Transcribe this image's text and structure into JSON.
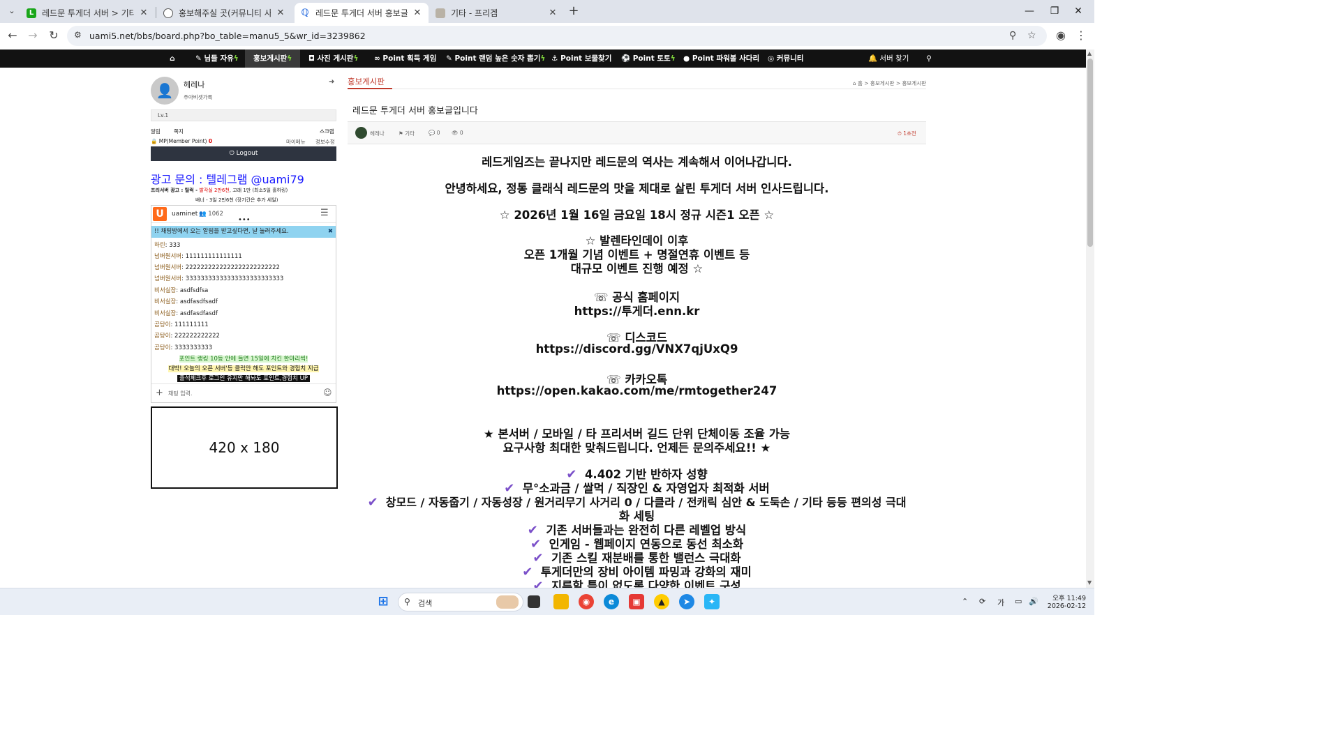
{
  "browser": {
    "tabs": [
      {
        "title": "레드문 투게더 서버 > 기타 프리",
        "active": false,
        "favicon_color": "#1aa61a",
        "favicon_letter": "L"
      },
      {
        "title": "홍보해주실 곳(커뮤니티 사이트",
        "active": false,
        "favicon_color": "#666666",
        "favicon_letter": ""
      },
      {
        "title": "레드문 투게더 서버 홍보글입니",
        "active": true,
        "favicon_color": "#2a6de0",
        "favicon_letter": ""
      },
      {
        "title": "기타 - 프리겜",
        "active": false,
        "favicon_color": "#888888",
        "favicon_letter": ""
      }
    ],
    "new_tab_glyph": "+",
    "url": "uami5.net/bbs/board.php?bo_table=manu5_5&wr_id=3239862"
  },
  "site_nav": {
    "items": [
      {
        "label": "님들 자유",
        "bolt": true,
        "icon": "pencil-icon"
      },
      {
        "label": "홍보게시판",
        "bolt": true,
        "active": true
      },
      {
        "label": "사진 게시판",
        "bolt": true,
        "icon": "camera-icon"
      },
      {
        "label": "Point 획득 게임",
        "bolt": false,
        "icon": "gamepad-icon"
      },
      {
        "label": "Point 랜덤 높은 숫자 뽑기",
        "bolt": true,
        "icon": "pencil-icon"
      },
      {
        "label": "Point 보물찾기",
        "bolt": false,
        "icon": "anchor-icon"
      },
      {
        "label": "Point 토토",
        "bolt": true,
        "icon": "soccer-icon"
      },
      {
        "label": "Point 파워볼 사다리",
        "bolt": false,
        "icon": "ball-icon"
      },
      {
        "label": "커뮤니티",
        "bolt": false,
        "icon": "eye-icon"
      },
      {
        "label": "서버 찾기",
        "bolt": false,
        "icon": "bell-icon"
      }
    ]
  },
  "sidebar": {
    "username": "헤레나",
    "subtitle": "주아비셋가륵",
    "level": "Lv.1",
    "links": [
      "알림",
      "쪽지",
      "스크랩"
    ],
    "mp_label": "MP(Member Point)",
    "mp_value": "0",
    "my_links": [
      "마이메뉴",
      "정보수정"
    ],
    "logout": "Logout",
    "ad_title": "광고 문의 :  텔레그램 @uami79",
    "ad_line1_prefix": "프리서버 광고 : 틸럭 - ",
    "ad_line1_price": "발각실 2만6천",
    "ad_line1_suffix": ", 고래 1만 (최소5일 홀하링)",
    "ad_line2": "배너 - 3일 2만6천 (장기간은 추가 세일)"
  },
  "chat": {
    "room": "uaminet",
    "users": "1062",
    "notice": "!! 채팅방에서 오는 알림을 받고싶다면, 날 눌러주세요.",
    "messages": [
      {
        "nick": "하린",
        "text": "333"
      },
      {
        "nick": "넘버원서버",
        "text": "111111111111111"
      },
      {
        "nick": "넘버원서버",
        "text": "2222222222222222222222222"
      },
      {
        "nick": "넘버원서버",
        "text": "33333333333333333333333333"
      },
      {
        "nick": "비서실장",
        "text": "asdfsdfsa"
      },
      {
        "nick": "비서실장",
        "text": "asdfasdfsadf"
      },
      {
        "nick": "비서실장",
        "text": "asdfasdfasdf"
      },
      {
        "nick": "곰탕이",
        "text": "111111111"
      },
      {
        "nick": "곰탕이",
        "text": "222222222222"
      },
      {
        "nick": "곰탕이",
        "text": "3333333333"
      }
    ],
    "promos": [
      "포인트 랭킹 10등 안에 들면 15일에 치킨 한마리씩!",
      "대박! 오늘의 오픈 서버'등 클릭만 해도 포인트와 경험치 지급",
      "출석체크후 로그인 유지만 해놔도 포인트,경험치 UP"
    ],
    "input_placeholder": "채팅 입력."
  },
  "adbox": "420 x 180",
  "board": {
    "tab": "홍보게시판",
    "breadcrumb": "홈 > 홍보게시판 > 홍보게시판",
    "post_title": "레드문 투게더 서버 홍보글입니다",
    "author": "헤레나",
    "category": "기타",
    "comments": "0",
    "views": "0",
    "time": "1초전"
  },
  "post_body": [
    "레드게임즈는 끝나지만 레드문의 역사는 계속해서 이어나갑니다.",
    "안녕하세요, 정통 클래식 레드문의 맛을 제대로 살린 투게더 서버 인사드립니다.",
    "☆ 2026년 1월 16일 금요일 18시 정규 시즌1 오픈 ☆",
    "☆ 발렌타인데이 이후",
    "오픈 1개월 기념 이벤트 + 명절연휴 이벤트 등",
    "대규모 이벤트 진행 예정 ☆",
    "☏ 공식 홈페이지",
    "https://투게더.enn.kr",
    "☏ 디스코드",
    "https://discord.gg/VNX7qjUxQ9",
    "☏ 카카오톡",
    "https://open.kakao.com/me/rmtogether247",
    "★ 본서버 / 모바일 / 타 프리서버 길드 단위 단체이동 조율 가능",
    "요구사항 최대한 맞춰드립니다. 언제든 문의주세요!! ★"
  ],
  "features": [
    "4.402 기반 반하자 성향",
    "무°소과금 / 쌀먹 / 직장인 & 자영업자 최적화 서버",
    "창모드 / 자동줍기 / 자동성장 / 원거리무기 사거리 0 / 다클라 / 전캐릭 심안 & 도둑손 / 기타 등등 편의성 극대",
    "화 세팅",
    "기존 서버들과는 완전히 다른 레벨업 방식",
    "인게임 - 웹페이지 연동으로 동선 최소화",
    "기존 스킬 재분배를 통한 밸런스 극대화",
    "투게더만의 장비 아이템 파밍과 강화의 재미",
    "지루할 틈이 없도록 다양한 이벤트 구성"
  ],
  "taskbar": {
    "search": "검색",
    "time": "오후 11:49",
    "date": "2026-02-12",
    "ime": "가"
  }
}
